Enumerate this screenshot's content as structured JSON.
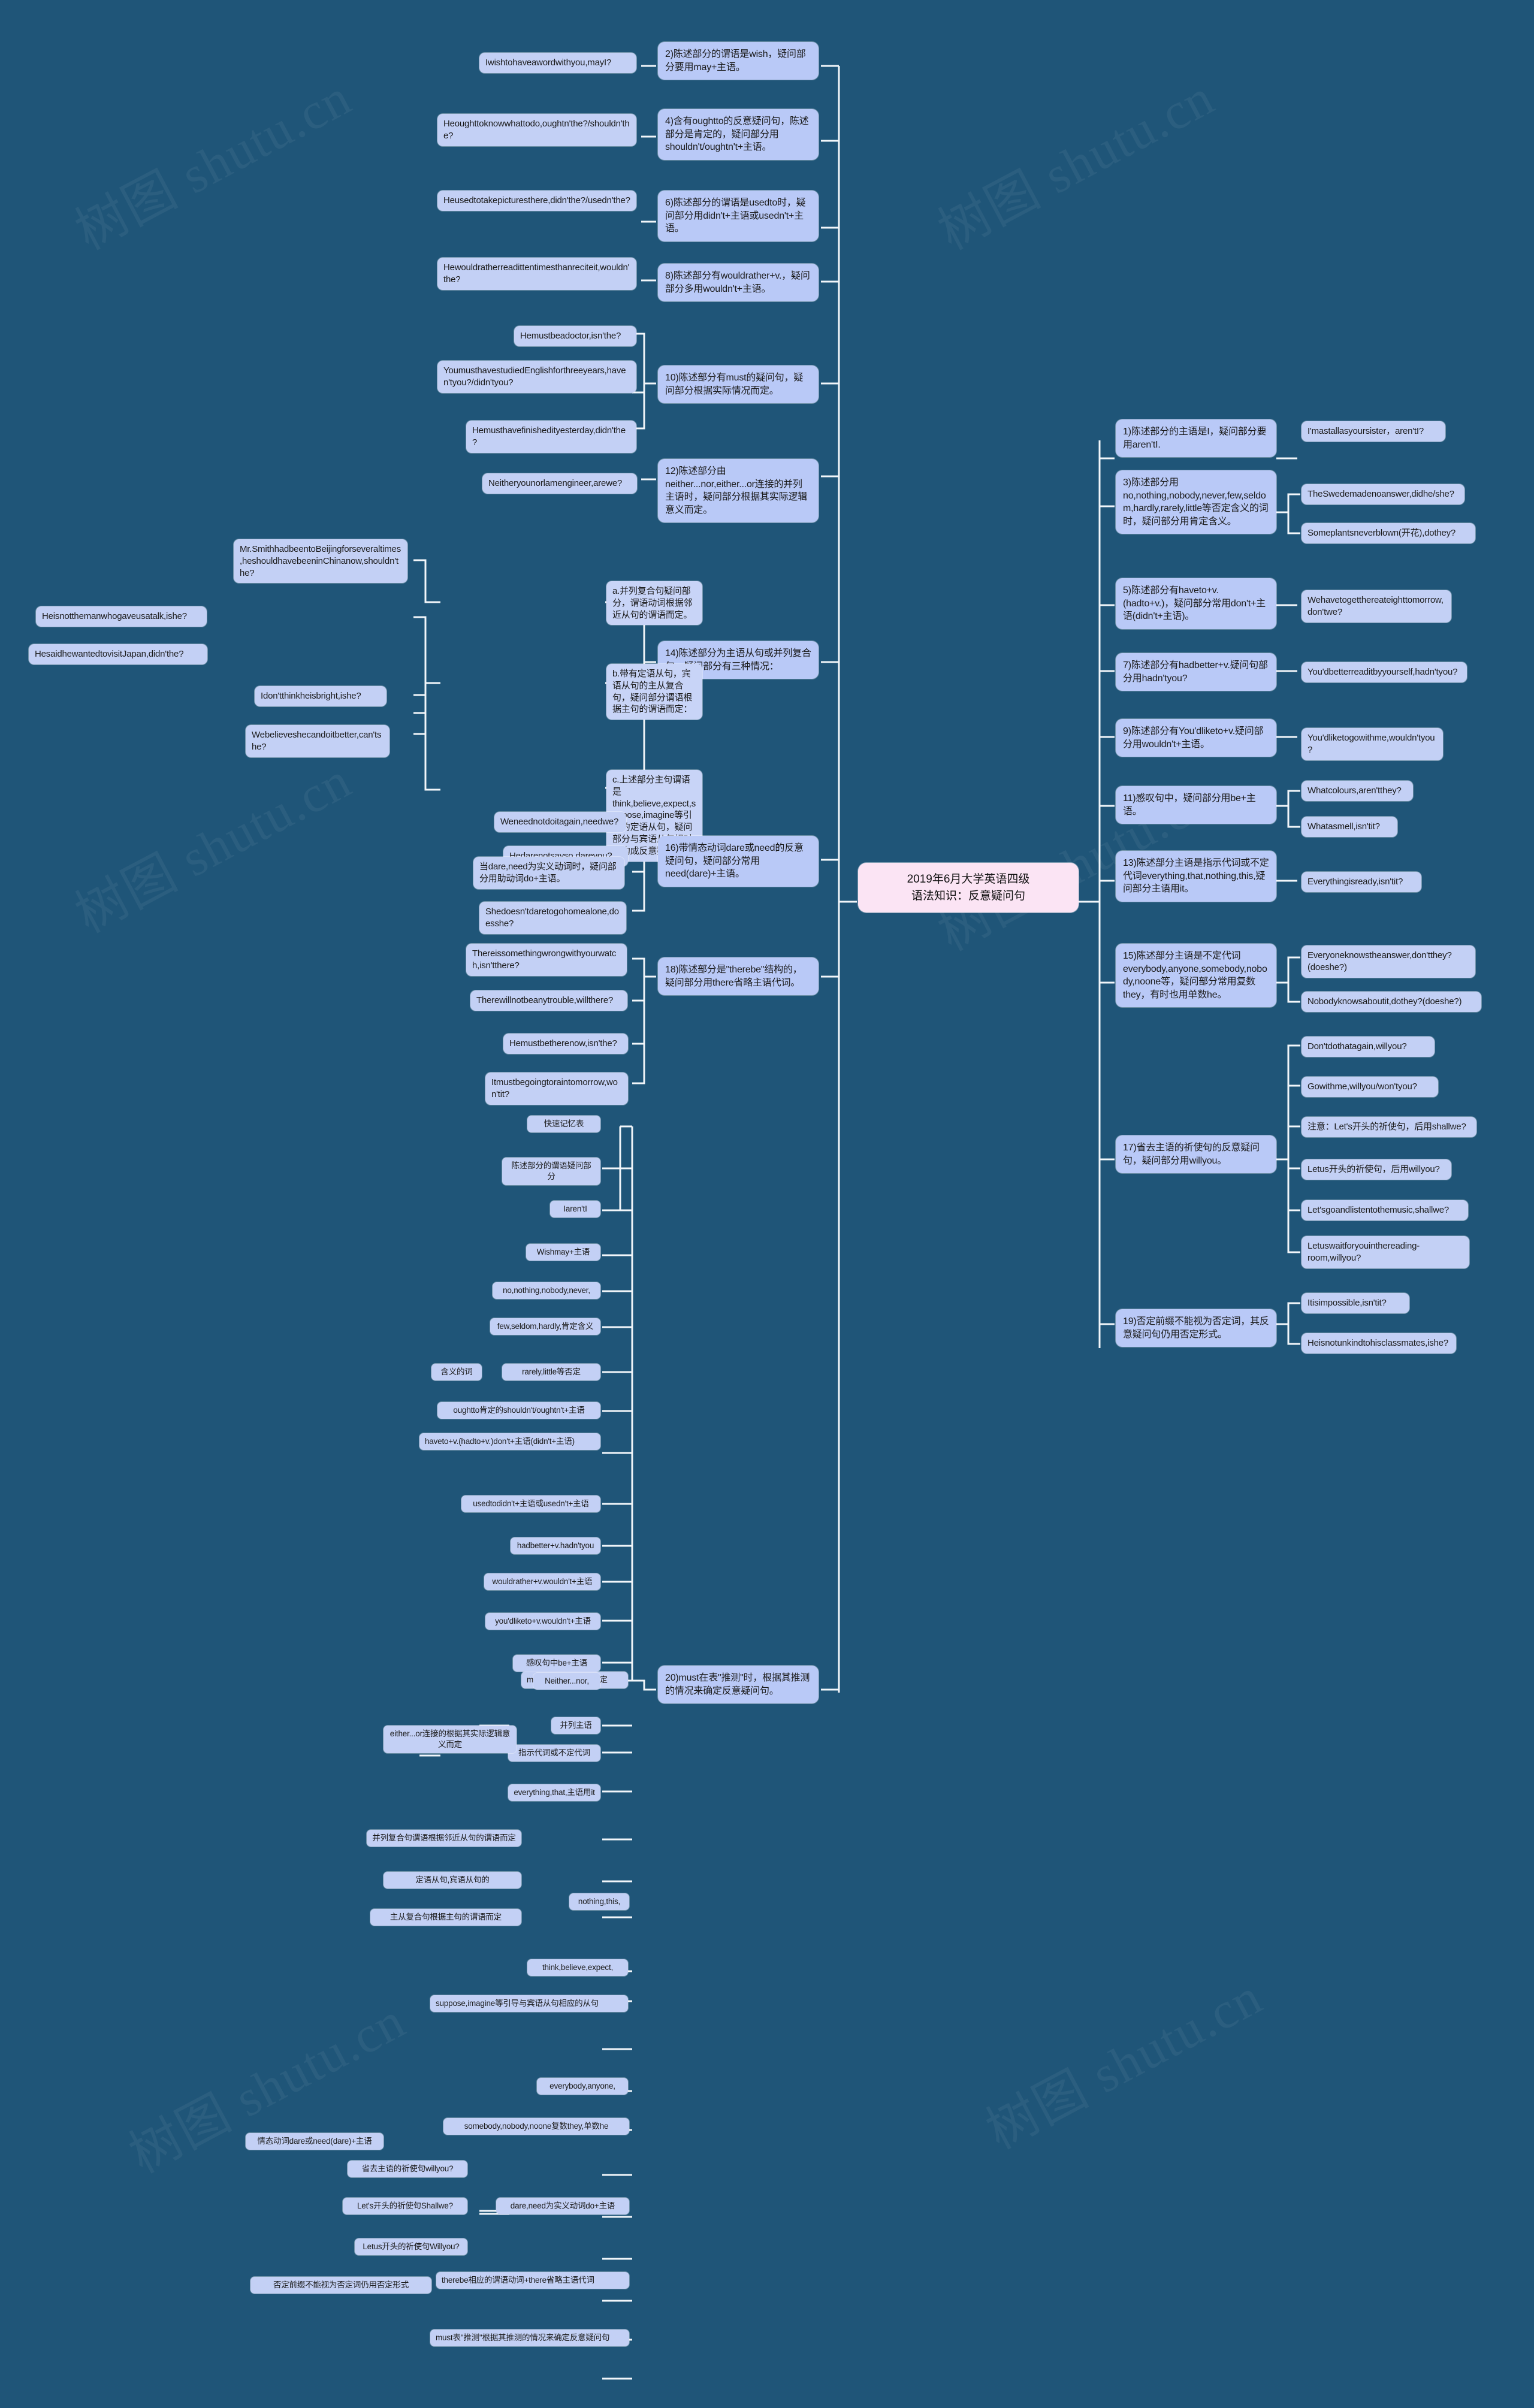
{
  "meta": {
    "background_color": "#1f5578",
    "node_color": "#c3d0f5",
    "root_color": "#fbe4f4",
    "line_color": "#f2f6fa"
  },
  "watermarks": [
    "树图 shutu.cn",
    "树图 shutu.cn",
    "树图 shutu.cn",
    "树图 shutu.cn",
    "树图 shutu.cn",
    "树图 shutu.cn"
  ],
  "root": {
    "title": "2019年6月大学英语四级\n语法知识：反意疑问句"
  },
  "rules_right": [
    {
      "id": "r1",
      "text": "1)陈述部分的主语是I，疑问部分要用aren'tI.",
      "examples": [
        "I'mastallasyoursister，aren'tI?"
      ]
    },
    {
      "id": "r3",
      "text": "3)陈述部分用no,nothing,nobody,never,few,seldom,hardly,rarely,little等否定含义的词时，疑问部分用肯定含义。",
      "examples": [
        "TheSwedemadenoanswer,didhe/she?",
        "Someplantsneverblown(开花),dothey?"
      ]
    },
    {
      "id": "r5",
      "text": "5)陈述部分有haveto+v.(hadto+v.)，疑问部分常用don't+主语(didn't+主语)。",
      "examples": [
        "Wehavetogetthereateighttomorrow,don'twe?"
      ]
    },
    {
      "id": "r7",
      "text": "7)陈述部分有hadbetter+v.疑问句部分用hadn'tyou?",
      "examples": [
        "You'dbetterreaditbyyourself,hadn'tyou?"
      ]
    },
    {
      "id": "r9",
      "text": "9)陈述部分有You'dliketo+v.疑问部分用wouldn't+主语。",
      "examples": [
        "You'dliketogowithme,wouldn'tyou?"
      ]
    },
    {
      "id": "r11",
      "text": "11)感叹句中，疑问部分用be+主语。",
      "examples": [
        "Whatcolours,aren'tthey?",
        "Whatasmell,isn'tit?"
      ]
    },
    {
      "id": "r13",
      "text": "13)陈述部分主语是指示代词或不定代词everything,that,nothing,this,疑问部分主语用it。",
      "examples": [
        "Everythingisready,isn'tit?"
      ]
    },
    {
      "id": "r15",
      "text": "15)陈述部分主语是不定代词everybody,anyone,somebody,nobody,noone等，疑问部分常用复数they，有时也用单数he。",
      "examples": [
        "Everyoneknowstheanswer,don'tthey?(doeshe?)",
        "Nobodyknowsaboutit,dothey?(doeshe?)"
      ]
    },
    {
      "id": "r17",
      "text": "17)省去主语的祈使句的反意疑问句，疑问部分用willyou。",
      "examples": [
        "Don'tdothatagain,willyou?",
        "Gowithme,willyou/won'tyou?",
        "注意：Let's开头的祈使句，后用shallwe?",
        "Letus开头的祈使句，后用willyou?",
        "Let'sgoandlistentothemusic,shallwe?",
        "Letuswaitforyouinthereading-room,willyou?"
      ]
    },
    {
      "id": "r19",
      "text": "19)否定前缀不能视为否定词，其反意疑问句仍用否定形式。",
      "examples": [
        "Itisimpossible,isn'tit?",
        "Heisnotunkindtohisclassmates,ishe?"
      ]
    }
  ],
  "rules_left": [
    {
      "id": "r2",
      "text": "2)陈述部分的谓语是wish，疑问部分要用may+主语。",
      "examples": [
        "Iwishtohaveawordwithyou,mayI?"
      ]
    },
    {
      "id": "r4",
      "text": "4)含有oughtto的反意疑问句，陈述部分是肯定的，疑问部分用shouldn't/oughtn't+主语。",
      "examples": [
        "Heoughttoknowwhattodo,oughtn'the?/shouldn'the?"
      ]
    },
    {
      "id": "r6",
      "text": "6)陈述部分的谓语是usedto时，疑问部分用didn't+主语或usedn't+主语。",
      "examples": [
        "Heusedtotakepicturesthere,didn'the?/usedn'the?"
      ]
    },
    {
      "id": "r8",
      "text": "8)陈述部分有wouldrather+v.，疑问部分多用wouldn't+主语。",
      "examples": [
        "Hewouldratherreadittentimesthanreciteit,wouldn'the?"
      ]
    },
    {
      "id": "r10",
      "text": "10)陈述部分有must的疑问句，疑问部分根据实际情况而定。",
      "examples": [
        "Hemustbeadoctor,isn'the?",
        "YoumusthavestudiedEnglishforthreeyears,haven'tyou?/didn'tyou?",
        "Hemusthavefinishedityesterday,didn'the?"
      ]
    },
    {
      "id": "r12",
      "text": "12)陈述部分由neither...nor,either...or连接的并列主语时，疑问部分根据其实际逻辑意义而定。",
      "examples": [
        "Neitheryounorlamengineer,arewe?"
      ]
    },
    {
      "id": "r14",
      "text": "14)陈述部分为主语从句或并列复合句，疑问部分有三种情况：",
      "sub": [
        {
          "text": "a.并列复合句疑问部分，谓语动词根据邻近从句的谓语而定。",
          "examples": [
            "Mr.SmithhadbeentoBeijingforseveraltimes,heshouldhavebeeninChinanow,shouldn'the?"
          ]
        },
        {
          "text": "b.带有定语从句，宾语从句的主从复合句，疑问部分谓语根据主句的谓语而定：",
          "examples": [
            "Heisnotthemanwhogaveusatalk,ishe?",
            "HesaidhewantedtovisitJapan,didn'the?"
          ]
        },
        {
          "text": "c.上述部分主句谓语是think,believe,expect,suppose,imagine等引导的定语从句，疑问部分与宾语从句相对应构成反意疑问句。",
          "examples": [
            "Idon'tthinkheisbright,ishe?",
            "Webelieveshecandoitbetter,can'tshe?"
          ]
        }
      ]
    },
    {
      "id": "r16",
      "text": "16)带情态动词dare或need的反意疑问句，疑问部分常用need(dare)+主语。",
      "examples": [
        "Weneednotdoitagain,needwe?",
        "Hedarenotsayso,dareyou?",
        "当dare,need为实义动词时，疑问部分用助动词do+主语。",
        "Shedoesn'tdaretogohomealone,doesshe?"
      ]
    },
    {
      "id": "r18",
      "text": "18)陈述部分是\"therebe\"结构的，疑问部分用there省略主语代词。",
      "examples": [
        "Thereissomethingwrongwithyourwatch,isn'tthere?",
        "Therewillnotbeanytrouble,willthere?",
        "Hemustbetherenow,isn'the?",
        "Itmustbegoingtoraintomorrow,won'tit?"
      ]
    },
    {
      "id": "r20",
      "text": "20)must在表\"推测\"时，根据其推测的情况来确定反意疑问句。",
      "examples": [
        "must根据实际情况而定"
      ]
    }
  ],
  "memory_table": {
    "title": "快速记忆表",
    "column_header": "陈述部分的谓语疑问部分",
    "rows": [
      {
        "label": "Iaren'tI"
      },
      {
        "label": "Wishmay+主语"
      },
      {
        "label": "no,nothing,nobody,never,"
      },
      {
        "label": "few,seldom,hardly,肯定含义"
      },
      {
        "label": "rarely,little等否定",
        "group": "含义的词"
      },
      {
        "label": "oughtto肯定的shouldn't/oughtn't+主语"
      },
      {
        "label": "haveto+v.(hadto+v.)don't+主语(didn't+主语)"
      },
      {
        "label": "usedtodidn't+主语或usedn't+主语"
      },
      {
        "label": "hadbetter+v.hadn'tyou"
      },
      {
        "label": "wouldrather+v.wouldn't+主语"
      },
      {
        "label": "you'dliketo+v.wouldn't+主语"
      },
      {
        "label": "感叹句中be+主语"
      },
      {
        "label": "Neither...nor,",
        "group": "must根据实际情况而定"
      },
      {
        "label": "并列主语"
      },
      {
        "label": "指示代词或不定代词",
        "group": "either...or连接的根据其实际逻辑意义而定"
      },
      {
        "label": "everything,that,主语用it"
      },
      {
        "label": "并列复合句谓语根据邻近从句的谓语而定"
      },
      {
        "label": "定语从句,宾语从句的",
        "group": "nothing,this,"
      },
      {
        "label": "主从复合句根据主句的谓语而定"
      },
      {
        "label": "think,believe,expect,"
      },
      {
        "label": "suppose,imagine等引导与宾语从句相应的从句"
      },
      {
        "label": "everybody,anyone,"
      },
      {
        "label": "情态动词dare或need(dare)+主语",
        "group": "somebody,nobody,noone复数they,单数he"
      },
      {
        "label": "省去主语的祈使句willyou?"
      },
      {
        "label": "Let's开头的祈使句Shallwe?",
        "group": "dare,need为实义动词do+主语"
      },
      {
        "label": "Letus开头的祈使句Willyou?"
      },
      {
        "label": "否定前缀不能视为否定词仍用否定形式",
        "group": "therebe相应的谓语动词+there省略主语代词"
      },
      {
        "label": "must表\"推测\"根据其推测的情况来确定反意疑问句"
      }
    ]
  }
}
